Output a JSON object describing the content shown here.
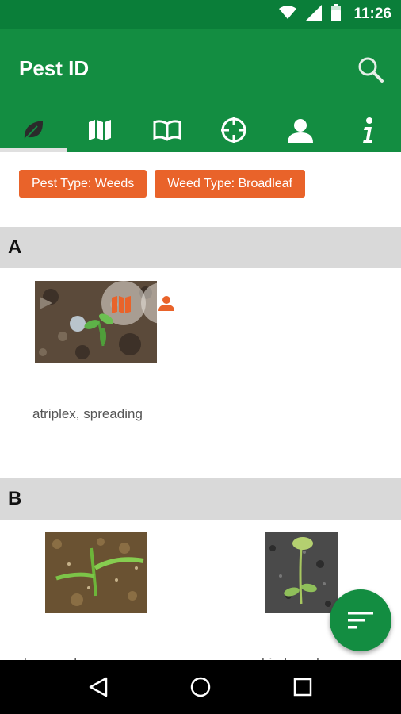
{
  "status_bar": {
    "time": "11:26",
    "icons": [
      "wifi-icon",
      "signal-icon",
      "battery-icon"
    ]
  },
  "app_bar": {
    "title": "Pest ID",
    "search_icon": "search-icon"
  },
  "tabs": [
    {
      "icon": "leaf-icon",
      "active": true
    },
    {
      "icon": "map-icon",
      "active": false
    },
    {
      "icon": "book-icon",
      "active": false
    },
    {
      "icon": "crosshair-icon",
      "active": false
    },
    {
      "icon": "person-icon",
      "active": false
    },
    {
      "icon": "info-icon",
      "active": false
    }
  ],
  "filters": [
    {
      "label": "Pest Type: Weeds"
    },
    {
      "label": "Weed Type: Broadleaf"
    }
  ],
  "sections": [
    {
      "letter": "A",
      "items": [
        {
          "label": "atriplex, spreading",
          "overlay_icons": [
            "map-icon",
            "person-icon"
          ]
        }
      ]
    },
    {
      "letter": "B",
      "items": [
        {
          "label": "barnyardgrass"
        },
        {
          "label": "bindweed"
        }
      ]
    }
  ],
  "colors": {
    "primary": "#138d41",
    "status": "#0a7e39",
    "accent": "#e9632a",
    "section_bg": "#d9d9d9"
  },
  "fab": {
    "icon": "filter-icon"
  },
  "nav": [
    "back-icon",
    "home-icon",
    "recents-icon"
  ]
}
